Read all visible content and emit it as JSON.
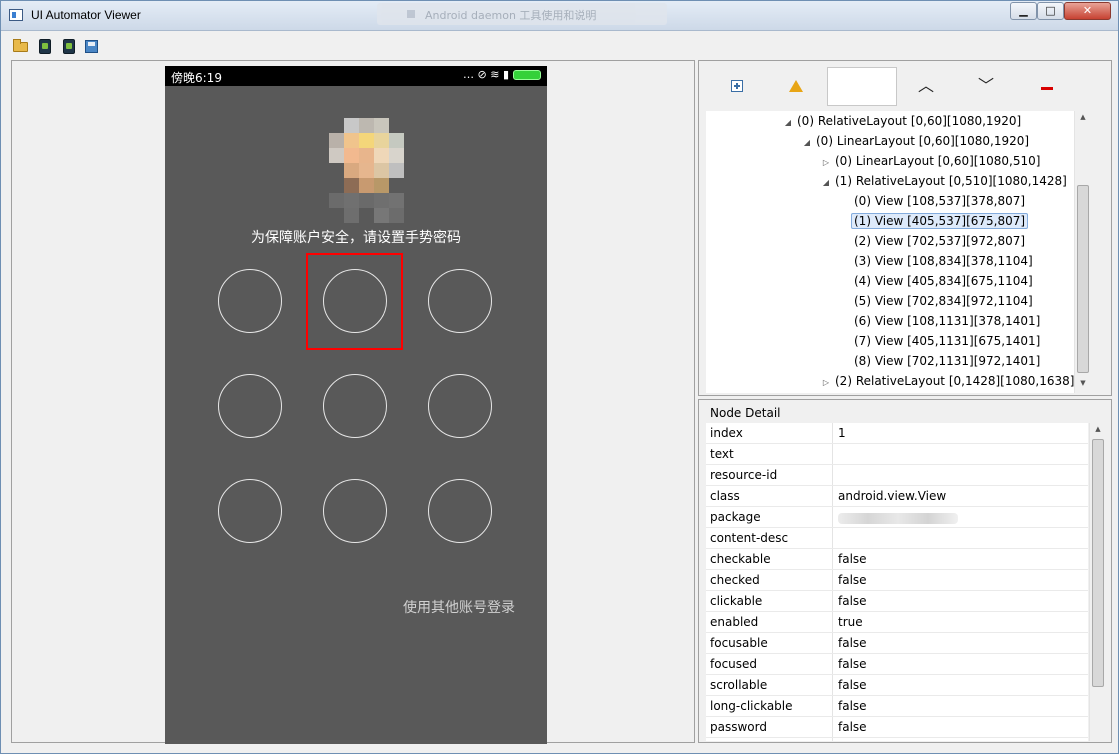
{
  "window": {
    "title": "UI Automator Viewer",
    "background_tab_title": "Android daemon 工具使用和说明",
    "minimize_glyph": "▁",
    "maximize_glyph": "□",
    "close_glyph": "✕"
  },
  "toolbar": {
    "icons": [
      "open-folder-icon",
      "device-screenshot-icon",
      "device-screenshot-compressed-icon",
      "save-icon"
    ]
  },
  "phone": {
    "status_time": "傍晚6:19",
    "status_icons": "… ⊘ ≋ ▮",
    "prompt": "为保障账户安全，请设置手势密码",
    "other_account": "使用其他账号登录",
    "pattern_count": 9,
    "highlighted_node_index": 1
  },
  "tree_toolbar": {
    "up_glyph": "︿",
    "down_glyph": "﹀"
  },
  "tree": {
    "nodes": [
      {
        "label": "(0) RelativeLayout [0,60][1080,1920]",
        "arrow": "◢",
        "depth": 0
      },
      {
        "label": "(0) LinearLayout [0,60][1080,1920]",
        "arrow": "◢",
        "depth": 1
      },
      {
        "label": "(0) LinearLayout [0,60][1080,510]",
        "arrow": "▷",
        "depth": 2
      },
      {
        "label": "(1) RelativeLayout [0,510][1080,1428]",
        "arrow": "◢",
        "depth": 2
      },
      {
        "label": "(0) View [108,537][378,807]",
        "arrow": "",
        "depth": 3
      },
      {
        "label": "(1) View [405,537][675,807]",
        "arrow": "",
        "depth": 3,
        "selected": true
      },
      {
        "label": "(2) View [702,537][972,807]",
        "arrow": "",
        "depth": 3
      },
      {
        "label": "(3) View [108,834][378,1104]",
        "arrow": "",
        "depth": 3
      },
      {
        "label": "(4) View [405,834][675,1104]",
        "arrow": "",
        "depth": 3
      },
      {
        "label": "(5) View [702,834][972,1104]",
        "arrow": "",
        "depth": 3
      },
      {
        "label": "(6) View [108,1131][378,1401]",
        "arrow": "",
        "depth": 3
      },
      {
        "label": "(7) View [405,1131][675,1401]",
        "arrow": "",
        "depth": 3
      },
      {
        "label": "(8) View [702,1131][972,1401]",
        "arrow": "",
        "depth": 3
      },
      {
        "label": "(2) RelativeLayout [0,1428][1080,1638]",
        "arrow": "▷",
        "depth": 2
      }
    ]
  },
  "node_detail": {
    "title": "Node Detail",
    "rows": [
      {
        "key": "index",
        "value": "1"
      },
      {
        "key": "text",
        "value": ""
      },
      {
        "key": "resource-id",
        "value": ""
      },
      {
        "key": "class",
        "value": "android.view.View"
      },
      {
        "key": "package",
        "value": "",
        "blurred": true
      },
      {
        "key": "content-desc",
        "value": ""
      },
      {
        "key": "checkable",
        "value": "false"
      },
      {
        "key": "checked",
        "value": "false"
      },
      {
        "key": "clickable",
        "value": "false"
      },
      {
        "key": "enabled",
        "value": "true"
      },
      {
        "key": "focusable",
        "value": "false"
      },
      {
        "key": "focused",
        "value": "false"
      },
      {
        "key": "scrollable",
        "value": "false"
      },
      {
        "key": "long-clickable",
        "value": "false"
      },
      {
        "key": "password",
        "value": "false"
      }
    ]
  },
  "colors": {
    "highlight": "#ff0000",
    "phone_bg": "#595959",
    "selected_row": "#deeafa"
  }
}
